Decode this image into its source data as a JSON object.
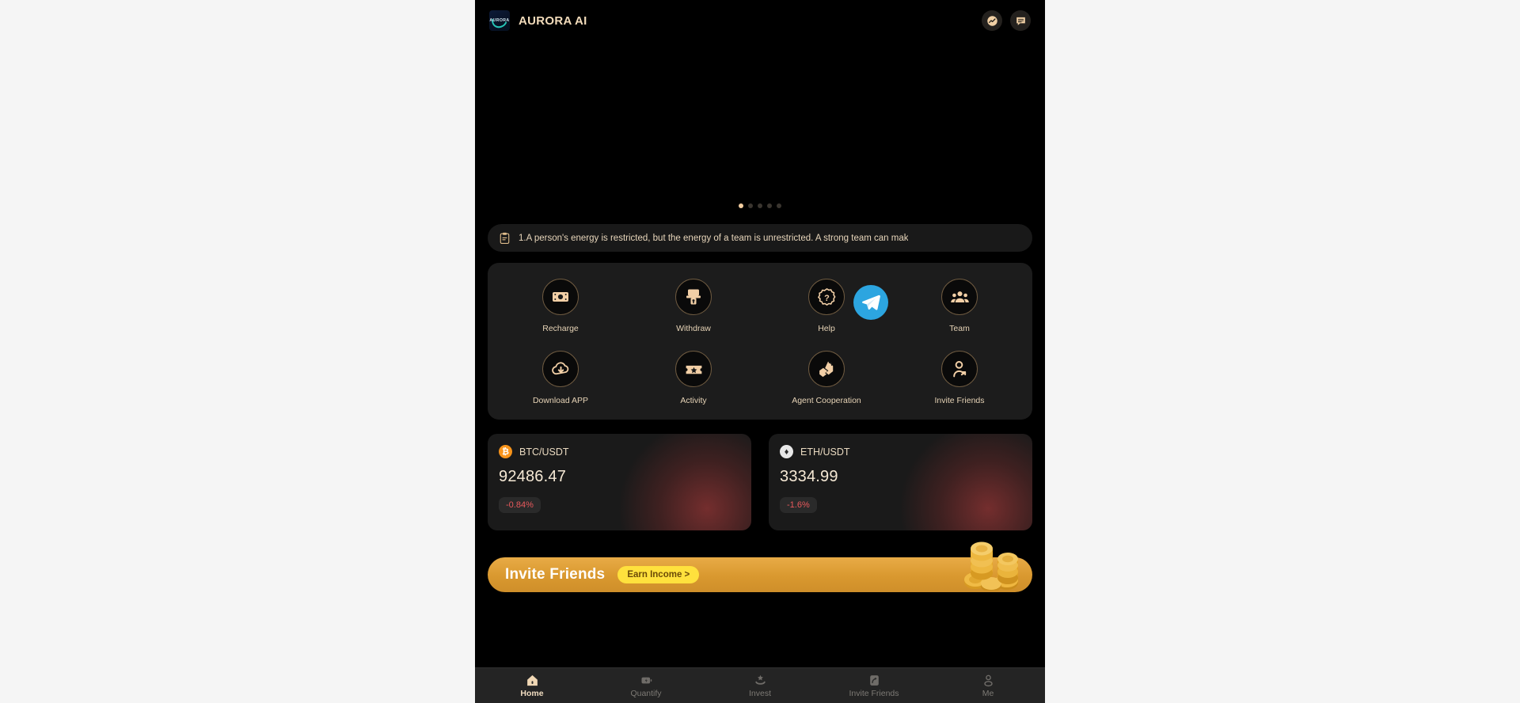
{
  "header": {
    "brand_name": "AURORA AI",
    "logo_word": "AURORA",
    "actions": [
      {
        "name": "market-chart-button",
        "icon": "chart-trend-icon"
      },
      {
        "name": "message-button",
        "icon": "message-icon"
      }
    ]
  },
  "carousel": {
    "slide_count": 5,
    "active_index": 0
  },
  "notice": {
    "icon": "clipboard-icon",
    "text": "1.A person's energy is restricted, but the energy of a team is unrestricted. A strong team can mak"
  },
  "quick_grid": {
    "row1": [
      {
        "label": "Recharge",
        "icon": "banknote-icon"
      },
      {
        "label": "Withdraw",
        "icon": "atm-withdraw-icon"
      },
      {
        "label": "Help",
        "icon": "question-badge-icon"
      },
      {
        "label": "Team",
        "icon": "people-group-icon"
      }
    ],
    "row2": [
      {
        "label": "Download APP",
        "icon": "cloud-download-icon"
      },
      {
        "label": "Activity",
        "icon": "ticket-star-icon"
      },
      {
        "label": "Agent Cooperation",
        "icon": "handshake-agent-icon"
      },
      {
        "label": "Invite Friends",
        "icon": "person-share-icon"
      }
    ]
  },
  "markets": [
    {
      "pair": "BTC/USDT",
      "symbol": "₿",
      "price": "92486.47",
      "change": "-0.84%",
      "coin_class": "btc"
    },
    {
      "pair": "ETH/USDT",
      "symbol": "♦",
      "price": "3334.99",
      "change": "-1.6%",
      "coin_class": "eth"
    }
  ],
  "invite_banner": {
    "title": "Invite Friends",
    "cta": "Earn Income >"
  },
  "bottom_nav": [
    {
      "label": "Home",
      "icon": "home-icon",
      "active": true
    },
    {
      "label": "Quantify",
      "icon": "quantify-icon",
      "active": false
    },
    {
      "label": "Invest",
      "icon": "invest-icon",
      "active": false
    },
    {
      "label": "Invite Friends",
      "icon": "invite-friends-icon",
      "active": false
    },
    {
      "label": "Me",
      "icon": "person-icon",
      "active": false
    }
  ],
  "floating": {
    "telegram_label": "Telegram",
    "icon": "telegram-icon"
  },
  "colors": {
    "accent_gold": "#f2cda0",
    "brand_text": "#f3dcbb",
    "banner_gold": "#d9982f",
    "pill_yellow": "#ffe13d",
    "down_red": "#e8595c",
    "telegram_blue": "#2ca5e0",
    "page_bg": "#f5f5f5",
    "phone_bg": "#000000"
  }
}
